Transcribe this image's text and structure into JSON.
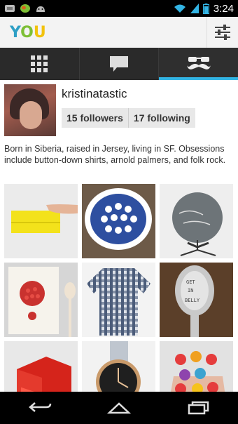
{
  "status_bar": {
    "time": "3:24",
    "icons": [
      "notification-icon",
      "chat-notification-icon",
      "android-icon",
      "wifi-icon",
      "battery-icon",
      "signal-icon"
    ]
  },
  "app": {
    "logo": {
      "y": "Y",
      "o": "O",
      "u": "U"
    },
    "filter_icon": "sliders-icon"
  },
  "tabs": [
    {
      "icon": "grid-icon",
      "active": false
    },
    {
      "icon": "chat-icon",
      "active": false
    },
    {
      "icon": "mustache-glasses-icon",
      "active": true
    }
  ],
  "profile": {
    "username": "kristinatastic",
    "followers": "15 followers",
    "following": "17 following",
    "bio": "Born in Siberia, raised in Jersey, living in SF. Obsessions include button-down shirts, arnold palmers, and folk rock."
  },
  "grid_items": [
    {
      "name": "yellow-clutch",
      "bg": "#e8e8e8"
    },
    {
      "name": "blue-plate",
      "bg": "#6e5b4a"
    },
    {
      "name": "chalk-globe",
      "bg": "#ececec"
    },
    {
      "name": "pomegranate-print",
      "bg": "#d8d8d8"
    },
    {
      "name": "plaid-shirt",
      "bg": "#f3f3f3"
    },
    {
      "name": "stamped-spoon",
      "bg": "#5a3f2a"
    },
    {
      "name": "red-drawers",
      "bg": "#e6e6e6"
    },
    {
      "name": "watch",
      "bg": "#f1f1f1"
    },
    {
      "name": "flower-rings",
      "bg": "#e2e2e2"
    }
  ],
  "nav": [
    "back-icon",
    "home-icon",
    "recents-icon"
  ]
}
